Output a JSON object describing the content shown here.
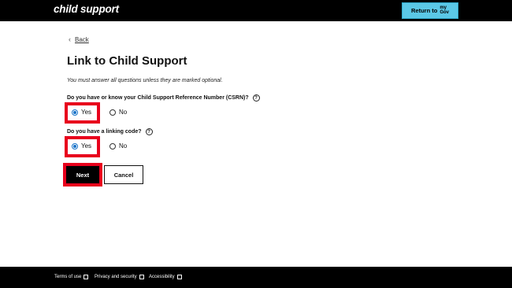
{
  "header": {
    "brand": "child support",
    "return_button": {
      "label": "Return to",
      "logo_top": "my",
      "logo_bottom": "Gov"
    }
  },
  "nav": {
    "back_label": "Back"
  },
  "page": {
    "title": "Link to Child Support",
    "intro": "You must answer all questions unless they are marked optional."
  },
  "questions": [
    {
      "label": "Do you have or know your Child Support Reference Number (CSRN)?",
      "options": [
        "Yes",
        "No"
      ],
      "selected": "Yes"
    },
    {
      "label": "Do you have a linking code?",
      "options": [
        "Yes",
        "No"
      ],
      "selected": "Yes"
    }
  ],
  "actions": {
    "next_label": "Next",
    "cancel_label": "Cancel"
  },
  "footer": {
    "links": [
      "Terms of use",
      "Privacy and security",
      "Accessibility"
    ]
  },
  "colors": {
    "header_bg": "#000000",
    "return_button_bg": "#5bc8e6",
    "highlight": "#e8001c",
    "radio_selected": "#1a73c8"
  }
}
